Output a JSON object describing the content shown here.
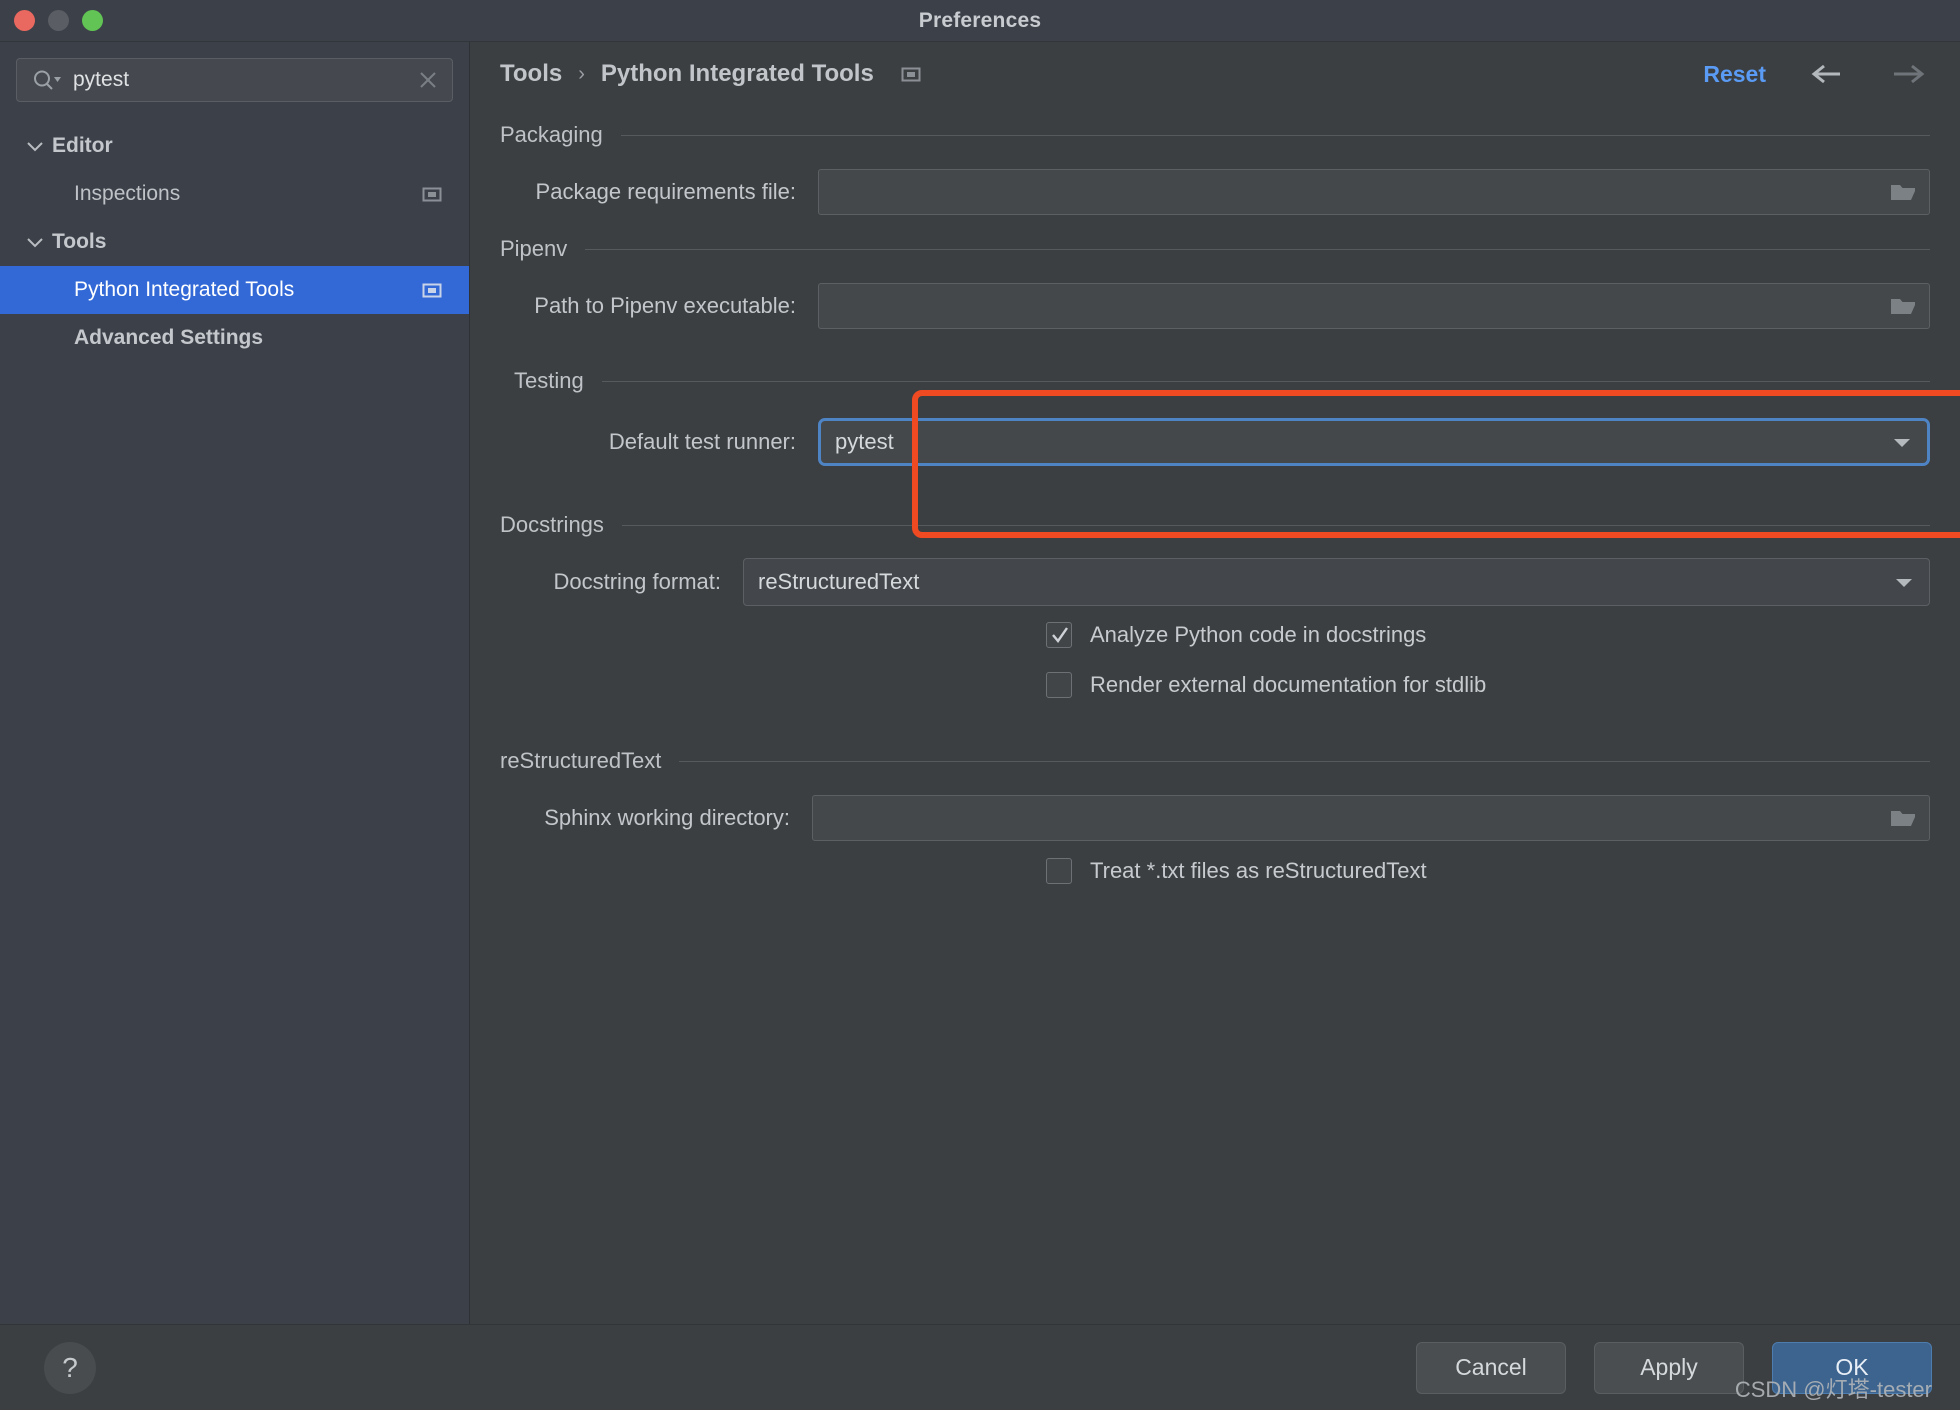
{
  "window": {
    "title": "Preferences",
    "traffic_lights": [
      "close-button",
      "minimize-button",
      "zoom-button"
    ]
  },
  "sidebar": {
    "search": {
      "value": "pytest",
      "placeholder": "",
      "icon": "search-icon",
      "clear_icon": "clear-icon"
    },
    "items": [
      {
        "label": "Editor",
        "level": 0,
        "group": true,
        "expanded": true,
        "selected": false,
        "icon": null
      },
      {
        "label": "Inspections",
        "level": 1,
        "group": false,
        "expanded": null,
        "selected": false,
        "icon": "settings-page-icon"
      },
      {
        "label": "Tools",
        "level": 0,
        "group": true,
        "expanded": true,
        "selected": false,
        "icon": null
      },
      {
        "label": "Python Integrated Tools",
        "level": 1,
        "group": false,
        "expanded": null,
        "selected": true,
        "icon": "settings-page-icon"
      },
      {
        "label": "Advanced Settings",
        "level": 0,
        "group": true,
        "expanded": null,
        "selected": false,
        "icon": null
      }
    ]
  },
  "header": {
    "breadcrumb": [
      "Tools",
      "Python Integrated Tools"
    ],
    "separator": "›",
    "page_icon": "settings-page-icon",
    "reset_label": "Reset",
    "back_icon": "arrow-left-icon",
    "forward_icon": "arrow-right-icon"
  },
  "sections": {
    "packaging": {
      "title": "Packaging",
      "field_label": "Package requirements file:",
      "field_value": "",
      "browse_icon": "folder-icon"
    },
    "pipenv": {
      "title": "Pipenv",
      "field_label": "Path to Pipenv executable:",
      "field_value": "",
      "browse_icon": "folder-icon"
    },
    "testing": {
      "title": "Testing",
      "field_label": "Default test runner:",
      "field_value": "pytest",
      "focused": true,
      "caret_icon": "chevron-down-icon",
      "highlight_color": "#f04a23"
    },
    "docstrings": {
      "title": "Docstrings",
      "field_label": "Docstring format:",
      "field_value": "reStructuredText",
      "caret_icon": "chevron-down-icon",
      "checkboxes": [
        {
          "label": "Analyze Python code in docstrings",
          "checked": true
        },
        {
          "label": "Render external documentation for stdlib",
          "checked": false
        }
      ]
    },
    "restructuredtext": {
      "title": "reStructuredText",
      "field_label": "Sphinx working directory:",
      "field_value": "",
      "browse_icon": "folder-icon",
      "checkboxes": [
        {
          "label": "Treat *.txt files as reStructuredText",
          "checked": false
        }
      ]
    }
  },
  "footer": {
    "help_label": "?",
    "cancel_label": "Cancel",
    "apply_label": "Apply",
    "ok_label": "OK",
    "watermark": "CSDN @灯塔-tester"
  },
  "colors": {
    "accent_blue": "#3369d6",
    "link_blue": "#5a9bf5",
    "focus_blue": "#4f84c4",
    "annotation_red": "#f04a23",
    "panel_bg": "#3c3f41",
    "sidebar_bg": "#3c4049"
  }
}
